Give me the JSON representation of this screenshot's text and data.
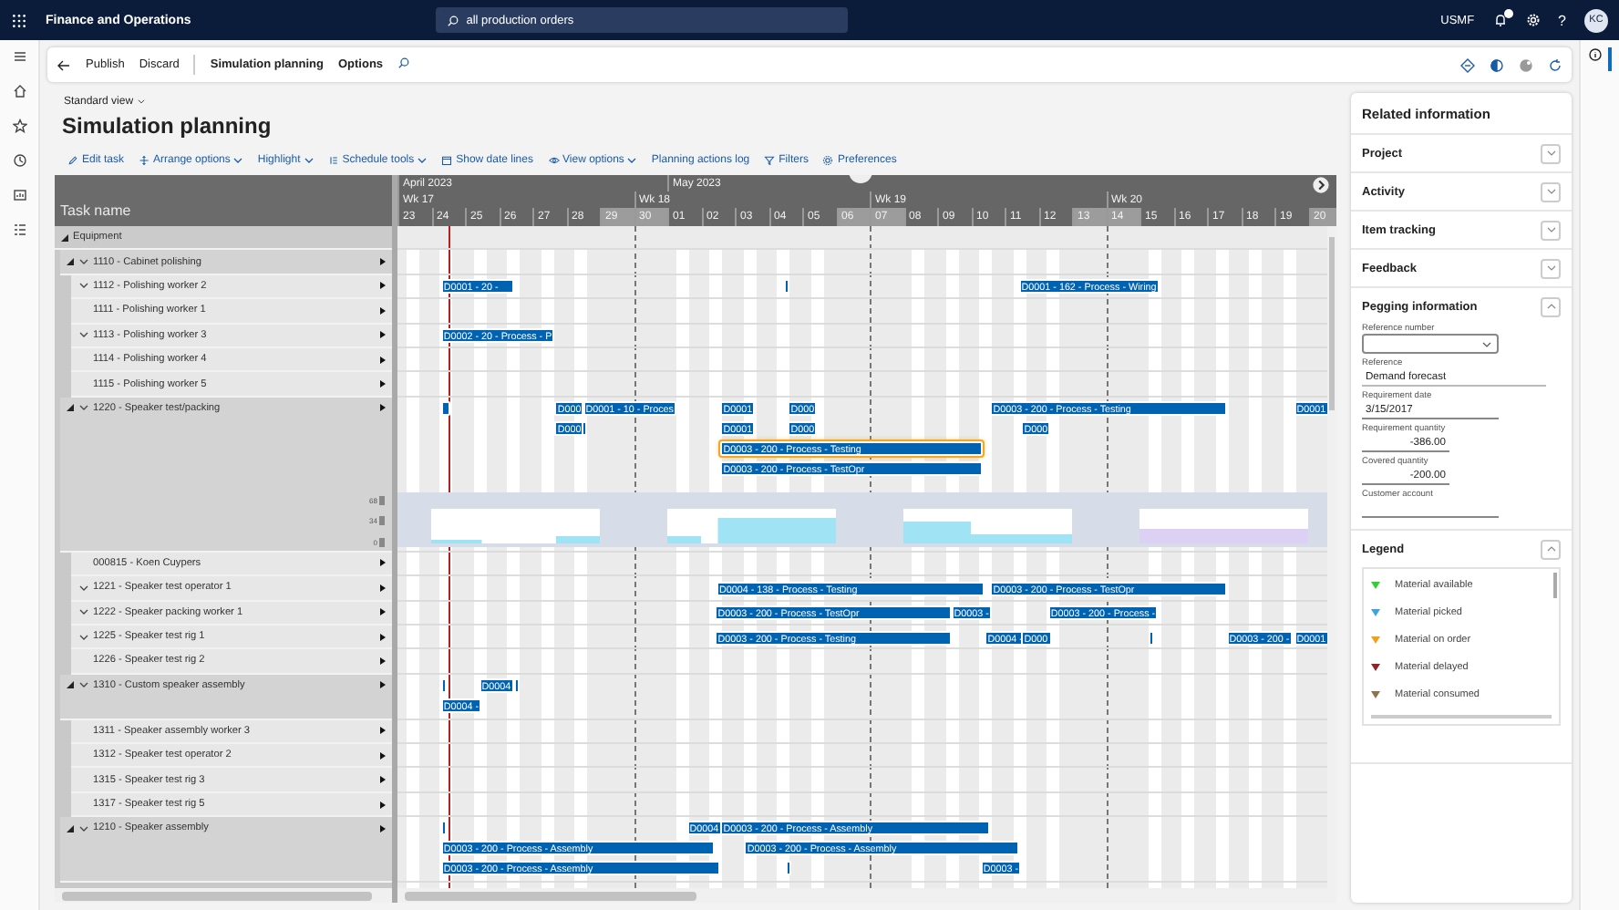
{
  "topbar": {
    "app_title": "Finance and Operations",
    "search": {
      "value": "all production orders"
    },
    "company": "USMF",
    "help_glyph": "?",
    "avatar": "KC"
  },
  "action_bar": {
    "buttons": [
      "Publish",
      "Discard"
    ],
    "tabs": [
      "Simulation planning",
      "Options"
    ]
  },
  "view": {
    "name": "Standard view"
  },
  "page_title": "Simulation planning",
  "toolbar": [
    {
      "label": "Edit task",
      "menu": false
    },
    {
      "label": "Arrange options",
      "menu": true
    },
    {
      "label": "Highlight",
      "menu": true
    },
    {
      "label": "Schedule tools",
      "menu": true
    },
    {
      "label": "Show date lines",
      "menu": false
    },
    {
      "label": "View options",
      "menu": true
    },
    {
      "label": "Planning actions log",
      "menu": false
    },
    {
      "label": "Filters",
      "menu": false
    },
    {
      "label": "Preferences",
      "menu": false
    }
  ],
  "gantt": {
    "task_header": "Task name",
    "timeline": {
      "months": [
        {
          "label": "April 2023"
        },
        {
          "label": "May 2023"
        }
      ],
      "weeks": [
        {
          "label": "Wk 17"
        },
        {
          "label": "Wk 18"
        },
        {
          "label": "Wk 19"
        },
        {
          "label": "Wk 20"
        }
      ],
      "days": [
        {
          "label": "23",
          "weekend": false
        },
        {
          "label": "24",
          "weekend": false
        },
        {
          "label": "25",
          "weekend": false
        },
        {
          "label": "26",
          "weekend": false
        },
        {
          "label": "27",
          "weekend": false
        },
        {
          "label": "28",
          "weekend": false
        },
        {
          "label": "29",
          "weekend": true
        },
        {
          "label": "30",
          "weekend": true
        },
        {
          "label": "01",
          "weekend": false
        },
        {
          "label": "02",
          "weekend": false
        },
        {
          "label": "03",
          "weekend": false
        },
        {
          "label": "04",
          "weekend": false
        },
        {
          "label": "05",
          "weekend": false
        },
        {
          "label": "06",
          "weekend": true
        },
        {
          "label": "07",
          "weekend": true
        },
        {
          "label": "08",
          "weekend": false
        },
        {
          "label": "09",
          "weekend": false
        },
        {
          "label": "10",
          "weekend": false
        },
        {
          "label": "11",
          "weekend": false
        },
        {
          "label": "12",
          "weekend": false
        },
        {
          "label": "13",
          "weekend": true
        },
        {
          "label": "14",
          "weekend": true
        },
        {
          "label": "15",
          "weekend": false
        },
        {
          "label": "16",
          "weekend": false
        },
        {
          "label": "17",
          "weekend": false
        },
        {
          "label": "18",
          "weekend": false
        },
        {
          "label": "19",
          "weekend": false
        },
        {
          "label": "20",
          "weekend": true
        }
      ]
    },
    "tasks": [
      {
        "name": "Equipment",
        "expanded": true,
        "children": [
          {
            "name": "1110 - Cabinet polishing",
            "expanded": true,
            "collapsible": true,
            "children": [
              {
                "name": "1112 - Polishing worker 2",
                "collapsible": true,
                "lanes": [
                  [
                    {
                      "label": "D0001 - 20 -",
                      "selected": false
                    },
                    {
                      "selected": false
                    },
                    {
                      "label": "D0001 - 162 - Process - Wiring",
                      "selected": false
                    }
                  ]
                ]
              },
              {
                "name": "1111 - Polishing worker 1",
                "collapsible": false
              },
              {
                "name": "1113 - Polishing worker 3",
                "collapsible": true,
                "lanes": [
                  [
                    {
                      "label": "D0002 - 20 - Process - P",
                      "selected": false
                    }
                  ]
                ]
              },
              {
                "name": "1114 - Polishing worker 4",
                "collapsible": false
              },
              {
                "name": "1115 - Polishing worker 5",
                "collapsible": false
              }
            ]
          },
          {
            "name": "1220 - Speaker test/packing",
            "expanded": true,
            "collapsible": true,
            "capacity": {
              "ticks": [
                "68",
                "34",
                "0"
              ]
            },
            "lanes": [
              [
                {
                  "selected": false
                },
                {
                  "label": "D000",
                  "selected": false
                },
                {
                  "label": "D0001 - 10 - Proces",
                  "selected": false
                },
                {
                  "label": "D0001",
                  "selected": false
                },
                {
                  "label": "D000",
                  "selected": false
                },
                {
                  "label": "D0003 - 200 - Process - Testing",
                  "selected": false
                },
                {
                  "label": "D0001",
                  "selected": false
                }
              ],
              [
                {
                  "label": "D000",
                  "selected": false
                },
                {
                  "selected": false
                },
                {
                  "label": "D0001",
                  "selected": false
                },
                {
                  "label": "D000",
                  "selected": false
                },
                {
                  "label": "D000",
                  "selected": false
                }
              ],
              [
                {
                  "label": "D0003 - 200 - Process - Testing",
                  "selected": true
                }
              ],
              [
                {
                  "label": "D0003 - 200 - Process - TestOpr",
                  "selected": false
                }
              ]
            ],
            "children": [
              {
                "name": "000815 - Koen Cuypers",
                "collapsible": false
              },
              {
                "name": "1221 - Speaker test operator 1",
                "collapsible": true,
                "lanes": [
                  [
                    {
                      "label": "D0004 - 138 - Process - Testing",
                      "selected": false
                    },
                    {
                      "label": "D0003 - 200 - Process - TestOpr",
                      "selected": false
                    }
                  ]
                ]
              },
              {
                "name": "1222 - Speaker packing worker 1",
                "collapsible": true,
                "lanes": [
                  [
                    {
                      "label": "D0003 - 200 - Process - TestOpr",
                      "selected": false
                    },
                    {
                      "label": "D0003 -",
                      "selected": false
                    },
                    {
                      "label": "D0003 - 200 - Process -",
                      "selected": false
                    }
                  ]
                ]
              },
              {
                "name": "1225 - Speaker test rig 1",
                "collapsible": true,
                "lanes": [
                  [
                    {
                      "label": "D0003 - 200 - Process - Testing",
                      "selected": false
                    },
                    {
                      "label": "D0004 -",
                      "selected": false
                    },
                    {
                      "label": "D000",
                      "selected": false
                    },
                    {
                      "selected": false
                    },
                    {
                      "label": "D0003 - 200 -",
                      "selected": false
                    },
                    {
                      "label": "D0001",
                      "selected": false
                    }
                  ]
                ]
              },
              {
                "name": "1226 - Speaker test rig 2",
                "collapsible": false
              }
            ]
          },
          {
            "name": "1310 - Custom speaker assembly",
            "expanded": true,
            "collapsible": true,
            "lanes": [
              [
                {
                  "selected": false
                },
                {
                  "label": "D0004",
                  "selected": false
                },
                {
                  "selected": false
                }
              ],
              [
                {
                  "label": "D0004 -",
                  "selected": false
                }
              ]
            ],
            "children": [
              {
                "name": "1311 - Speaker assembly worker 3",
                "collapsible": false
              },
              {
                "name": "1312 - Speaker test operator 2",
                "collapsible": false
              },
              {
                "name": "1315 - Speaker test rig 3",
                "collapsible": false
              },
              {
                "name": "1317 - Speaker test rig 5",
                "collapsible": false
              }
            ]
          },
          {
            "name": "1210 - Speaker assembly",
            "expanded": true,
            "collapsible": true,
            "lanes": [
              [
                {
                  "selected": false
                },
                {
                  "label": "D0004",
                  "selected": false
                },
                {
                  "label": "D0003 - 200 - Process - Assembly",
                  "selected": false
                }
              ],
              [
                {
                  "label": "D0003 - 200 - Process - Assembly",
                  "selected": false
                },
                {
                  "label": "D0003 - 200 - Process - Assembly",
                  "selected": false
                }
              ],
              [
                {
                  "label": "D0003 - 200 - Process - Assembly",
                  "selected": false
                },
                {
                  "selected": false
                },
                {
                  "label": "D0003 -",
                  "selected": false
                }
              ]
            ]
          }
        ]
      }
    ]
  },
  "related": {
    "title": "Related information",
    "sections": [
      {
        "title": "Project",
        "expanded": false
      },
      {
        "title": "Activity",
        "expanded": false
      },
      {
        "title": "Item tracking",
        "expanded": false
      },
      {
        "title": "Feedback",
        "expanded": false
      },
      {
        "title": "Pegging information",
        "expanded": true,
        "fields": [
          {
            "label": "Reference number",
            "kind": "dropdown"
          },
          {
            "label": "Reference",
            "kind": "text",
            "value": "Demand forecast"
          },
          {
            "label": "Requirement date",
            "kind": "date",
            "value": "3/15/2017"
          },
          {
            "label": "Requirement quantity",
            "kind": "number",
            "value": "-386.00"
          },
          {
            "label": "Covered quantity",
            "kind": "number",
            "value": "-200.00"
          },
          {
            "label": "Customer account",
            "kind": "date"
          }
        ]
      },
      {
        "title": "Legend",
        "expanded": true,
        "items": [
          {
            "label": "Material available",
            "color": "#2fd02f"
          },
          {
            "label": "Material picked",
            "color": "#3fa3e0"
          },
          {
            "label": "Material on order",
            "color": "#f2a01c"
          },
          {
            "label": "Material delayed",
            "color": "#8e2424"
          },
          {
            "label": "Material consumed",
            "color": "#8c7452"
          }
        ]
      }
    ]
  }
}
